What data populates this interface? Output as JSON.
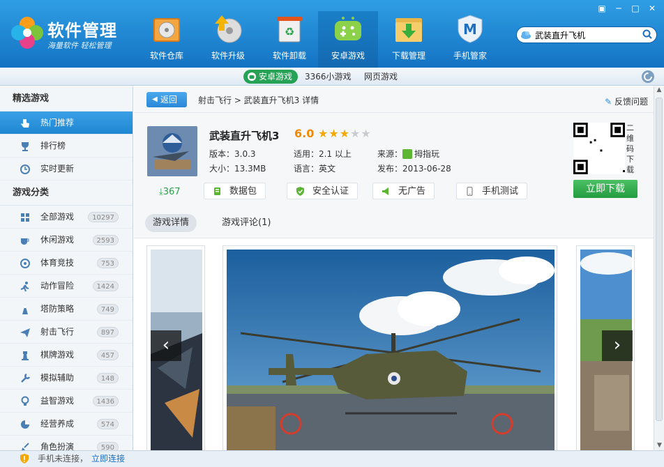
{
  "app": {
    "brand_title": "软件管理",
    "brand_subtitle": "海量软件 轻松管理"
  },
  "window": {
    "buttons": [
      "▣",
      "─",
      "□",
      "✕"
    ]
  },
  "nav": [
    {
      "label": "软件仓库",
      "icon": "disc-box-icon"
    },
    {
      "label": "软件升级",
      "icon": "upgrade-disc-icon"
    },
    {
      "label": "软件卸载",
      "icon": "recycle-bin-icon"
    },
    {
      "label": "安卓游戏",
      "icon": "android-game-icon",
      "active": true
    },
    {
      "label": "下载管理",
      "icon": "download-folder-icon"
    },
    {
      "label": "手机管家",
      "icon": "phone-shield-icon"
    }
  ],
  "search": {
    "value": "武装直升飞机"
  },
  "subtabs": [
    {
      "label": "安卓游戏",
      "active": true
    },
    {
      "label": "3366小游戏"
    },
    {
      "label": "网页游戏"
    }
  ],
  "sidebar": {
    "featured_header": "精选游戏",
    "featured": [
      {
        "label": "热门推荐",
        "icon": "hand-pointer-icon",
        "active": true
      },
      {
        "label": "排行榜",
        "icon": "trophy-icon"
      },
      {
        "label": "实时更新",
        "icon": "clock-icon"
      }
    ],
    "category_header": "游戏分类",
    "categories": [
      {
        "label": "全部游戏",
        "count": "10297",
        "icon": "grid-icon"
      },
      {
        "label": "休闲游戏",
        "count": "2593",
        "icon": "coffee-icon"
      },
      {
        "label": "体育竞技",
        "count": "753",
        "icon": "ball-icon"
      },
      {
        "label": "动作冒险",
        "count": "1424",
        "icon": "runner-icon"
      },
      {
        "label": "塔防策略",
        "count": "749",
        "icon": "tower-icon"
      },
      {
        "label": "射击飞行",
        "count": "897",
        "icon": "plane-icon"
      },
      {
        "label": "棋牌游戏",
        "count": "457",
        "icon": "chess-icon"
      },
      {
        "label": "模拟辅助",
        "count": "148",
        "icon": "wrench-icon"
      },
      {
        "label": "益智游戏",
        "count": "1436",
        "icon": "bulb-icon"
      },
      {
        "label": "经营养成",
        "count": "574",
        "icon": "pie-icon"
      },
      {
        "label": "角色扮演",
        "count": "590",
        "icon": "sword-icon"
      }
    ]
  },
  "breadcrumb": {
    "back": "返回",
    "path": "射击飞行 > 武装直升飞机3 详情",
    "feedback": "反馈问题"
  },
  "game": {
    "name": "武装直升飞机3",
    "score": "6.0",
    "rating": 3,
    "rating_max": 5,
    "version": "版本：3.0.3",
    "size": "大小：13.3MB",
    "compat": "适用：2.1 以上",
    "language": "语言：英文",
    "source_label": "来源：",
    "source": "拇指玩",
    "release": "发布：2013-06-28",
    "downloads": "367",
    "qr_label": "二维码下载",
    "download_button": "立即下载",
    "tags": [
      {
        "label": "数据包",
        "icon": "data-pack-icon"
      },
      {
        "label": "安全认证",
        "icon": "shield-check-icon"
      },
      {
        "label": "无广告",
        "icon": "megaphone-icon"
      },
      {
        "label": "手机测试",
        "icon": "phone-icon"
      }
    ]
  },
  "detail_tabs": [
    {
      "label": "游戏详情",
      "active": true
    },
    {
      "label": "游戏评论(1)"
    }
  ],
  "status": {
    "text": "手机未连接，",
    "link": "立即连接"
  },
  "colors": {
    "title_bar": "#1f86d2",
    "accent_green": "#249c3f",
    "score_orange": "#f18a00",
    "star_gold": "#f5a800"
  }
}
